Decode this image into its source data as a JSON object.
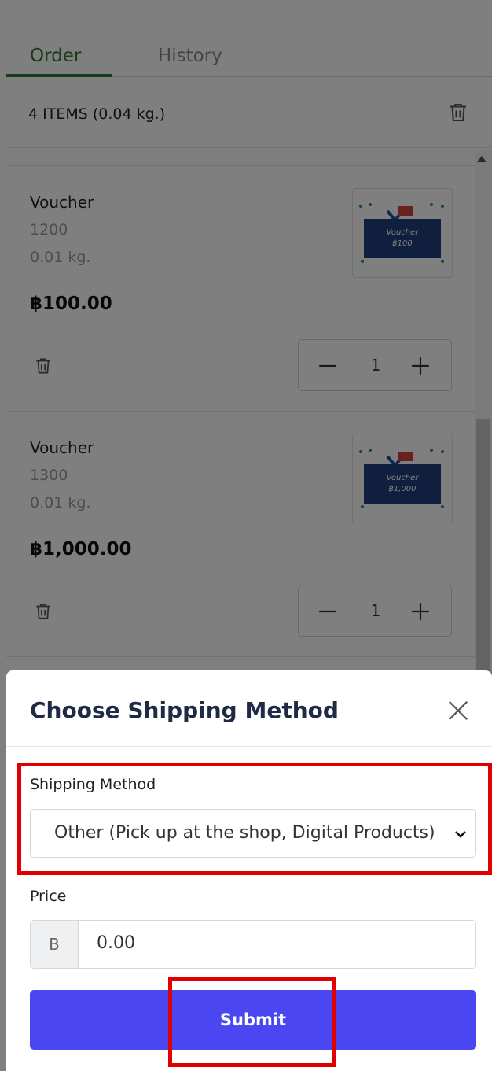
{
  "tabs": [
    {
      "label": "Order",
      "active": true
    },
    {
      "label": "History",
      "active": false
    }
  ],
  "summary": {
    "text": "4 ITEMS (0.04 kg.)",
    "icon": "trash-icon"
  },
  "items": [
    {
      "name": "Voucher",
      "code": "1200",
      "weight": "0.01 kg.",
      "price": "฿100.00",
      "quantity": "1",
      "image_text": "Voucher ฿100"
    },
    {
      "name": "Voucher",
      "code": "1300",
      "weight": "0.01 kg.",
      "price": "฿1,000.00",
      "quantity": "1",
      "image_text": "Voucher ฿1,000"
    }
  ],
  "modal": {
    "title": "Choose Shipping Method",
    "shipping_label": "Shipping Method",
    "shipping_value": "Other (Pick up at the shop, Digital Products)",
    "price_label": "Price",
    "currency": "B",
    "price_value": "0.00",
    "submit_label": "Submit"
  },
  "colors": {
    "accent_green": "#2e7d32",
    "submit_blue": "#4a46f2",
    "highlight_red": "#e00000"
  }
}
